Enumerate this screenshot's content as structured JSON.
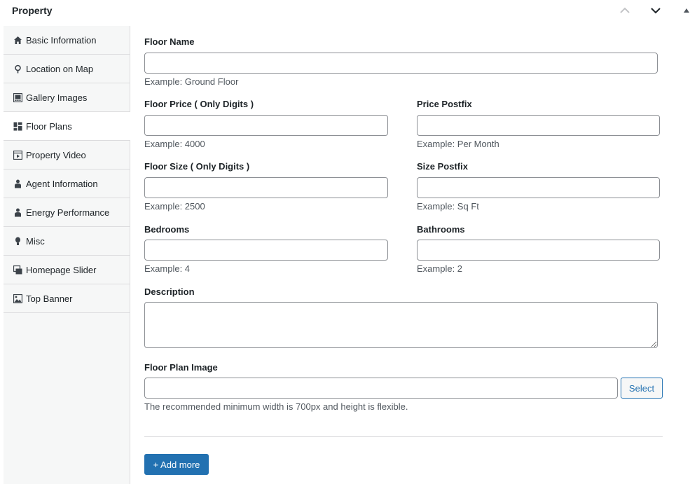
{
  "header": {
    "title": "Property"
  },
  "sidebar": {
    "items": [
      {
        "label": "Basic Information",
        "icon": "home-icon"
      },
      {
        "label": "Location on Map",
        "icon": "location-pin-icon"
      },
      {
        "label": "Gallery Images",
        "icon": "gallery-icon"
      },
      {
        "label": "Floor Plans",
        "icon": "floor-plans-icon",
        "active": true
      },
      {
        "label": "Property Video",
        "icon": "video-icon"
      },
      {
        "label": "Agent Information",
        "icon": "agent-icon"
      },
      {
        "label": "Energy Performance",
        "icon": "agent-icon"
      },
      {
        "label": "Misc",
        "icon": "lightbulb-icon"
      },
      {
        "label": "Homepage Slider",
        "icon": "slides-icon"
      },
      {
        "label": "Top Banner",
        "icon": "image-icon"
      }
    ]
  },
  "form": {
    "floor_name": {
      "label": "Floor Name",
      "value": "",
      "hint": "Example: Ground Floor"
    },
    "floor_price": {
      "label": "Floor Price ( Only Digits )",
      "value": "",
      "hint": "Example: 4000"
    },
    "price_postfix": {
      "label": "Price Postfix",
      "value": "",
      "hint": "Example: Per Month"
    },
    "floor_size": {
      "label": "Floor Size ( Only Digits )",
      "value": "",
      "hint": "Example: 2500"
    },
    "size_postfix": {
      "label": "Size Postfix",
      "value": "",
      "hint": "Example: Sq Ft"
    },
    "bedrooms": {
      "label": "Bedrooms",
      "value": "",
      "hint": "Example: 4"
    },
    "bathrooms": {
      "label": "Bathrooms",
      "value": "",
      "hint": "Example: 2"
    },
    "description": {
      "label": "Description",
      "value": ""
    },
    "floor_plan_image": {
      "label": "Floor Plan Image",
      "value": "",
      "hint": "The recommended minimum width is 700px and height is flexible.",
      "select_label": "Select"
    },
    "add_more_label": "+ Add more"
  },
  "colors": {
    "accent": "#2271b1",
    "sidebar_bg": "#f6f7f7",
    "border": "#dcdcde"
  }
}
